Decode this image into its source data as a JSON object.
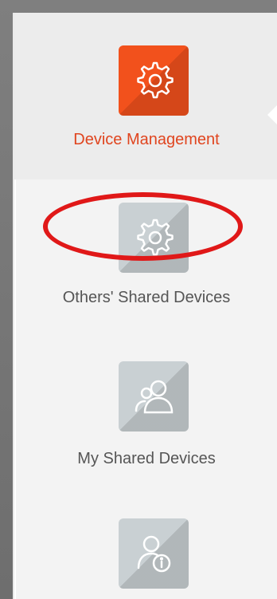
{
  "sidebar": {
    "items": [
      {
        "label": "Device Management",
        "icon": "gear-icon",
        "state": "active"
      },
      {
        "label": "Others' Shared Devices",
        "icon": "gear-icon",
        "state": "inactive"
      },
      {
        "label": "My Shared Devices",
        "icon": "users-icon",
        "state": "inactive"
      },
      {
        "label": "",
        "icon": "user-info-icon",
        "state": "inactive"
      }
    ]
  },
  "colors": {
    "accent": "#f2511c",
    "active_text": "#e0451f",
    "inactive_tile": "#c9d0d3",
    "highlight_ring": "#e01818"
  }
}
